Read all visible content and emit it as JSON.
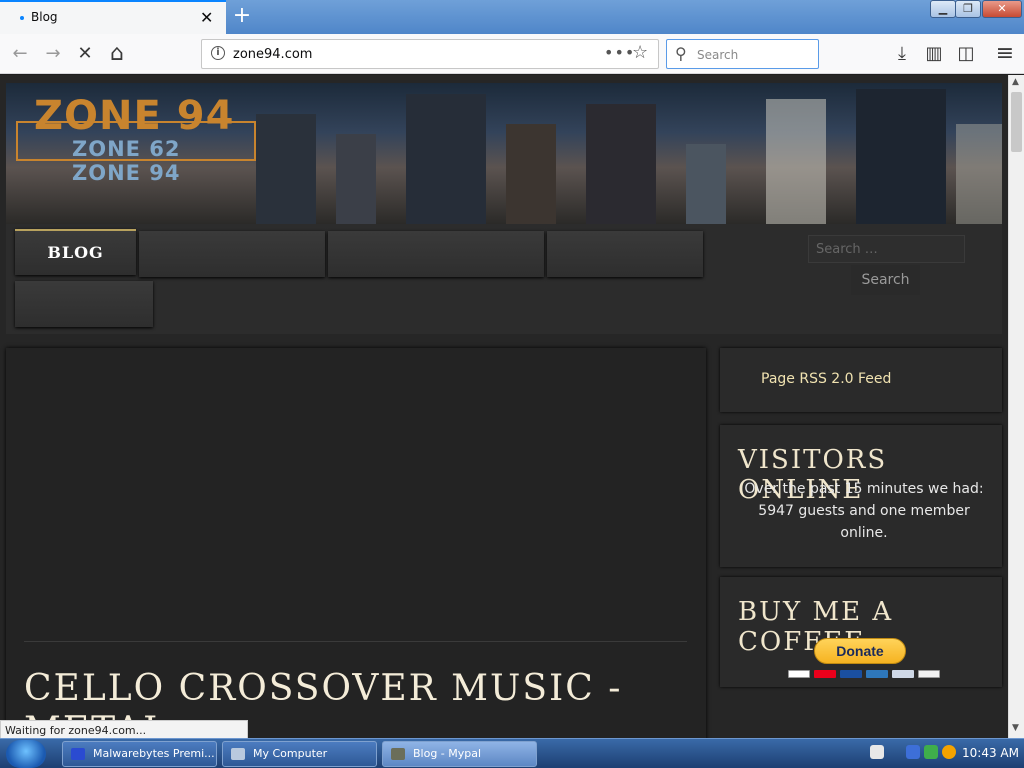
{
  "browser": {
    "tab": {
      "title": "Blog",
      "close_glyph": "✕"
    },
    "new_tab_glyph": "+",
    "window_controls": {
      "minimize": "▁",
      "restore": "❐",
      "close": "✕"
    },
    "nav": {
      "back_glyph": "←",
      "forward_glyph": "→",
      "stop_glyph": "✕",
      "home_glyph": "⌂"
    },
    "url": "zone94.com",
    "page_actions_glyph": "•••",
    "bookmark_glyph": "☆",
    "search": {
      "placeholder": "Search"
    },
    "toolbar_right": {
      "download_glyph": "⤓",
      "library_glyph": "▥",
      "sidebar_glyph": "◫",
      "menu_glyph": "≡"
    }
  },
  "site": {
    "logo": {
      "main": "ZONE 94",
      "sub1": "ZONE 62",
      "sub2": "ZONE 94"
    },
    "menu": [
      {
        "label": "BLOG"
      },
      {
        "label": ""
      },
      {
        "label": ""
      },
      {
        "label": ""
      },
      {
        "label": ""
      }
    ],
    "sidebar_search": {
      "placeholder": "Search …",
      "button": "Search"
    },
    "widgets": {
      "rss": {
        "link": "Page RSS 2.0 Feed"
      },
      "visitors": {
        "title": "VISITORS ONLINE",
        "text": "Over the past 15 minutes we had: 5947 guests and one member online."
      },
      "coffee": {
        "title": "BUY ME A COFFEE",
        "donate_label": "Donate"
      }
    },
    "post": {
      "title": "CELLO CROSSOVER MUSIC - METAL"
    }
  },
  "status_bar": {
    "text": "Waiting for zone94.com..."
  },
  "taskbar": {
    "items": [
      {
        "label": "Malwarebytes Premi..."
      },
      {
        "label": "My Computer"
      },
      {
        "label": "Blog - Mypal"
      }
    ],
    "clock": "10:43 AM"
  },
  "colors": {
    "accent": "#c8842e",
    "tab_indicator": "#0a84ff",
    "widget_title": "#f0e6cc",
    "donate": "#f6b321"
  }
}
